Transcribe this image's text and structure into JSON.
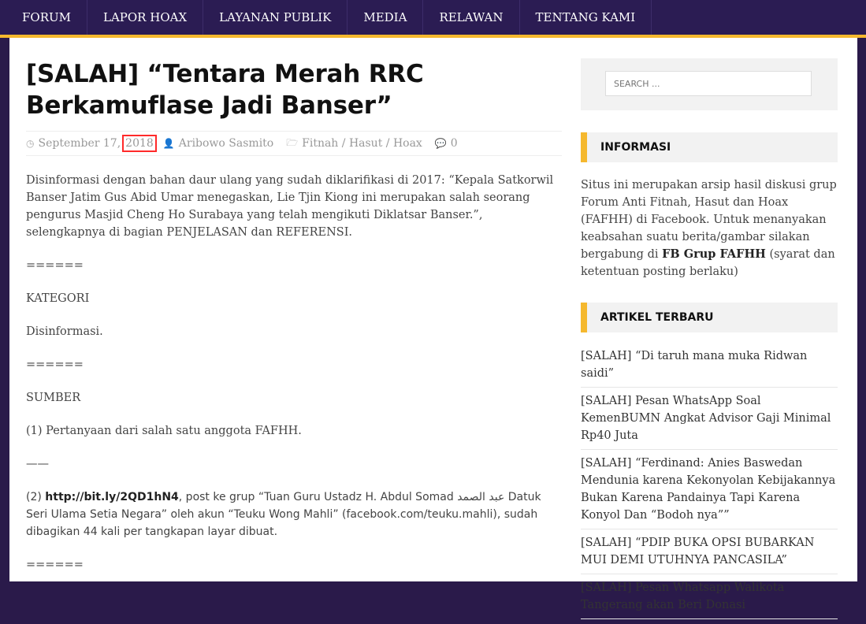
{
  "nav": {
    "items": [
      "FORUM",
      "LAPOR HOAX",
      "LAYANAN PUBLIK",
      "MEDIA",
      "RELAWAN",
      "TENTANG KAMI"
    ]
  },
  "article": {
    "title": "[SALAH] “Tentara Merah RRC Berkamuflase Jadi Banser”",
    "date_prefix": "September 17,",
    "date_year": "2018",
    "author": "Aribowo Sasmito",
    "category": "Fitnah / Hasut / Hoax",
    "comments": "0",
    "p1": "Disinformasi dengan bahan daur ulang yang sudah diklarifikasi di 2017: “Kepala Satkorwil Banser Jatim Gus Abid Umar menegaskan, Lie Tjin Kiong ini merupakan salah seorang pengurus Masjid Cheng Ho Surabaya yang telah mengikuti Diklatsar Banser.”, selengkapnya di bagian PENJELASAN dan REFERENSI.",
    "sep1": "======",
    "kategori": "KATEGORI",
    "disinformasi": "Disinformasi.",
    "sep2": "======",
    "sumber": "SUMBER",
    "src1": "(1) Pertanyaan dari salah satu anggota FAFHH.",
    "dash": "——",
    "src2_prefix": "(2) ",
    "src2_link": "http://bit.ly/2QD1hN4",
    "src2_rest": ", post ke grup “Tuan Guru Ustadz H. Abdul Somad عبد الصمد Datuk Seri Ulama Setia Negara” oleh akun “Teuku Wong Mahli” (facebook.com/teuku.mahli), sudah dibagikan 44 kali per tangkapan layar dibuat.",
    "sep3": "======"
  },
  "sidebar": {
    "search_placeholder": "SEARCH ...",
    "info_title": "INFORMASI",
    "info_text_1": "Situs ini merupakan arsip hasil diskusi grup Forum Anti Fitnah, Hasut dan Hoax (FAFHH) di Facebook. Untuk menanyakan keabsahan suatu berita/gambar silakan bergabung di ",
    "info_link": "FB Grup FAFHH",
    "info_text_2": " (syarat dan ketentuan posting berlaku)",
    "recent_title": "ARTIKEL TERBARU",
    "recent": [
      "[SALAH] “Di taruh mana muka Ridwan saidi”",
      "[SALAH] Pesan WhatsApp Soal KemenBUMN Angkat Advisor Gaji Minimal Rp40 Juta",
      "[SALAH] “Ferdinand: Anies Baswedan Mendunia karena Kekonyolan Kebijakannya Bukan Karena Pandainya Tapi Karena Konyol Dan “Bodoh nya””",
      "[SALAH] “PDIP BUKA OPSI BUBARKAN MUI DEMI UTUHNYA PANCASILA”",
      "[SALAH] Pesan Whatsapp Walikota Tangerang akan Beri Donasi"
    ]
  },
  "colors": {
    "nav_bg": "#2b1c53",
    "accent": "#f5b82e",
    "highlight_box": "#ff2a2a"
  }
}
